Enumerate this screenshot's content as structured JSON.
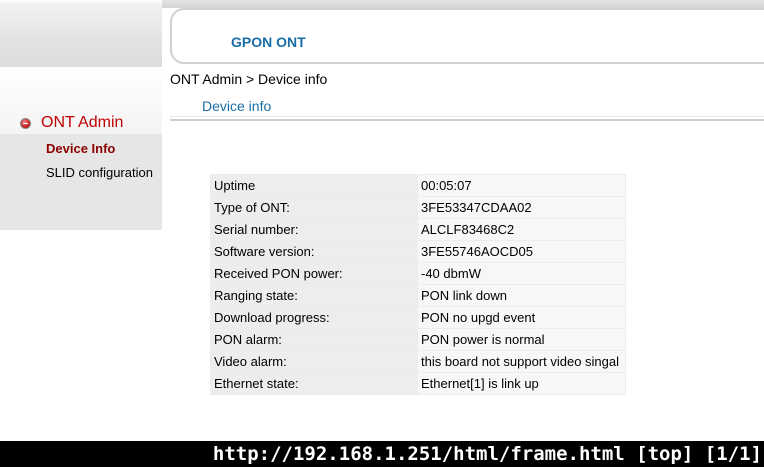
{
  "header": {
    "title": "GPON ONT"
  },
  "breadcrumb": "ONT Admin > Device info",
  "section_title": "Device info",
  "sidebar": {
    "menu_title": "ONT Admin",
    "items": [
      {
        "label": "Device Info"
      },
      {
        "label": "SLID configuration"
      }
    ]
  },
  "device_info": {
    "rows": [
      {
        "label": "Uptime",
        "value": "00:05:07"
      },
      {
        "label": "Type of ONT:",
        "value": "3FE53347CDAA02"
      },
      {
        "label": "Serial number:",
        "value": "ALCLF83468C2"
      },
      {
        "label": "Software version:",
        "value": "3FE55746AOCD05"
      },
      {
        "label": "Received PON power:",
        "value": "-40 dbmW"
      },
      {
        "label": "Ranging state:",
        "value": "PON link down"
      },
      {
        "label": "Download progress:",
        "value": "PON no upgd event"
      },
      {
        "label": "PON alarm:",
        "value": "PON power is normal"
      },
      {
        "label": "Video alarm:",
        "value": "this board not support video singal"
      },
      {
        "label": "Ethernet state:",
        "value": "Ethernet[1] is link up"
      }
    ]
  },
  "status_bar": {
    "text": "http://192.168.1.251/html/frame.html [top] [1/1]"
  }
}
